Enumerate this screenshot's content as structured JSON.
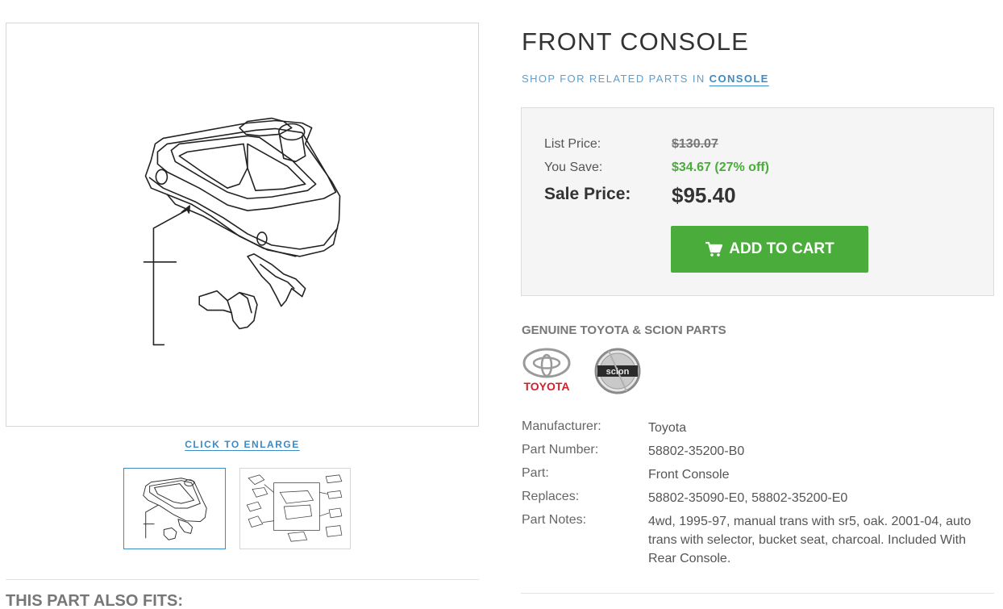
{
  "product": {
    "title": "FRONT CONSOLE",
    "related_prefix": "SHOP FOR RELATED PARTS IN",
    "related_category": "CONSOLE"
  },
  "gallery": {
    "enlarge_label": "CLICK TO ENLARGE",
    "thumbnails": [
      "front-console-thumbnail",
      "console-exploded-diagram-thumbnail"
    ],
    "selected_index": 0
  },
  "pricing": {
    "list_price_label": "List Price:",
    "list_price": "$130.07",
    "you_save_label": "You Save:",
    "you_save": "$34.67 (27% off)",
    "sale_price_label": "Sale Price:",
    "sale_price": "$95.40",
    "add_to_cart_label": "ADD TO CART"
  },
  "brands": {
    "heading": "GENUINE TOYOTA & SCION PARTS",
    "toyota_text": "TOYOTA",
    "scion_text": "scion"
  },
  "specs": [
    {
      "label": "Manufacturer:",
      "value": "Toyota"
    },
    {
      "label": "Part Number:",
      "value": "58802-35200-B0"
    },
    {
      "label": "Part:",
      "value": "Front Console"
    },
    {
      "label": "Replaces:",
      "value": "58802-35090-E0, 58802-35200-E0"
    },
    {
      "label": "Part Notes:",
      "value": "4wd, 1995-97, manual trans with sr5, oak. 2001-04, auto trans with selector, bucket seat, charcoal. Included With Rear Console."
    }
  ],
  "also_fits": {
    "heading": "THIS PART ALSO FITS:"
  },
  "colors": {
    "accent_blue": "#3d8bc4",
    "cart_green": "#4aac3a",
    "save_green": "#4aac3a",
    "toyota_red": "#d0202e"
  }
}
